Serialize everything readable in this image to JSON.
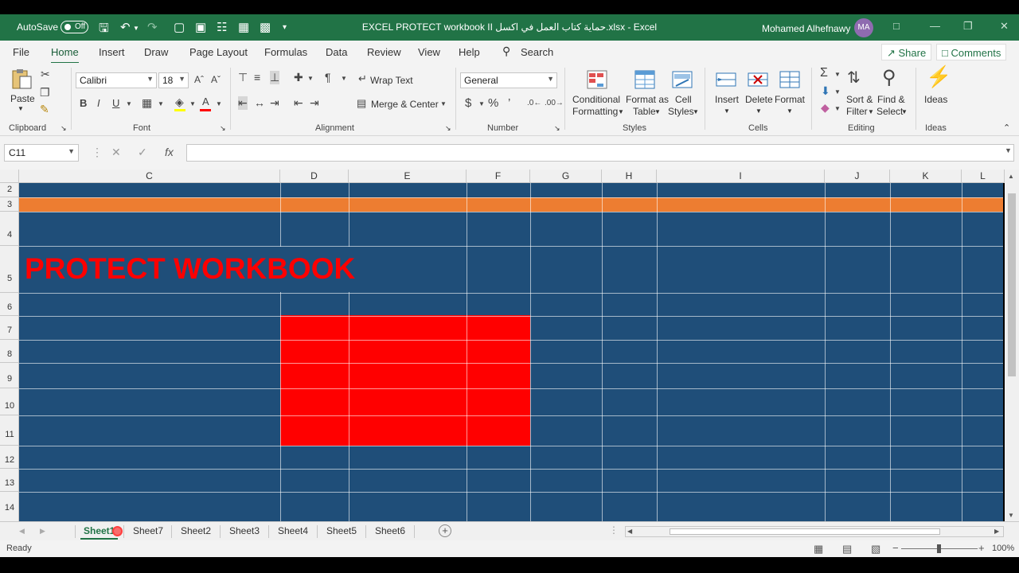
{
  "titlebar": {
    "autosave_label": "AutoSave",
    "autosave_state": "Off",
    "window_title": "EXCEL PROTECT workbook II حماية كتاب العمل في اكسل.xlsx  -  Excel",
    "user_name": "Mohamed Alhefnawy",
    "user_initials": "MA"
  },
  "menu": {
    "tabs": [
      "File",
      "Home",
      "Insert",
      "Draw",
      "Page Layout",
      "Formulas",
      "Data",
      "Review",
      "View",
      "Help"
    ],
    "search": "Search",
    "share": "Share",
    "comments": "Comments"
  },
  "ribbon": {
    "clipboard": {
      "label": "Clipboard",
      "paste": "Paste"
    },
    "font": {
      "label": "Font",
      "name": "Calibri",
      "size": "18"
    },
    "alignment": {
      "label": "Alignment",
      "wrap": "Wrap Text",
      "merge": "Merge & Center"
    },
    "number": {
      "label": "Number",
      "format": "General"
    },
    "styles": {
      "label": "Styles",
      "conditional1": "Conditional",
      "conditional2": "Formatting",
      "format_as1": "Format as",
      "format_as2": "Table",
      "cell1": "Cell",
      "cell2": "Styles"
    },
    "cells": {
      "label": "Cells",
      "insert": "Insert",
      "delete": "Delete",
      "format": "Format"
    },
    "editing": {
      "label": "Editing",
      "sort1": "Sort &",
      "sort2": "Filter",
      "find1": "Find &",
      "find2": "Select"
    },
    "ideas": {
      "label": "Ideas",
      "ideas": "Ideas"
    }
  },
  "formula_bar": {
    "name_box": "C11",
    "fx": "fx",
    "content": ""
  },
  "grid": {
    "columns": [
      "C",
      "D",
      "E",
      "F",
      "G",
      "H",
      "I",
      "J",
      "K",
      "L"
    ],
    "rows": [
      "2",
      "3",
      "4",
      "5",
      "6",
      "7",
      "8",
      "9",
      "10",
      "11",
      "12",
      "13",
      "14"
    ],
    "cell_text": "PROTECT WORKBOOK",
    "colors": {
      "background": "#1f4e79",
      "orange": "#ed7d31",
      "red": "#ff0000"
    }
  },
  "sheets": {
    "tabs": [
      "Sheet1",
      "Sheet7",
      "Sheet2",
      "Sheet3",
      "Sheet4",
      "Sheet5",
      "Sheet6"
    ],
    "active": "Sheet1"
  },
  "status": {
    "text": "Ready",
    "zoom": "100%"
  }
}
